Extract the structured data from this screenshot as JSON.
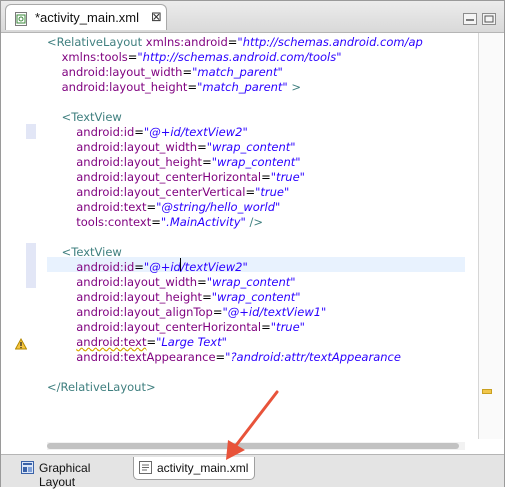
{
  "editor_tab": {
    "title": "*activity_main.xml",
    "close_glyph": "⊠"
  },
  "code_lines": [
    [
      {
        "c": "tag",
        "t": "<RelativeLayout "
      },
      {
        "c": "attr",
        "t": "xmlns:android"
      },
      {
        "c": "txt",
        "t": "="
      },
      {
        "c": "val",
        "t": "\"http://schemas.android.com/ap"
      }
    ],
    [
      {
        "c": "txt",
        "t": "    "
      },
      {
        "c": "attr",
        "t": "xmlns:tools"
      },
      {
        "c": "txt",
        "t": "="
      },
      {
        "c": "val",
        "t": "\"http://schemas.android.com/tools\""
      }
    ],
    [
      {
        "c": "txt",
        "t": "    "
      },
      {
        "c": "attr",
        "t": "android:layout_width"
      },
      {
        "c": "txt",
        "t": "="
      },
      {
        "c": "val",
        "t": "\"match_parent\""
      }
    ],
    [
      {
        "c": "txt",
        "t": "    "
      },
      {
        "c": "attr",
        "t": "android:layout_height"
      },
      {
        "c": "txt",
        "t": "="
      },
      {
        "c": "val",
        "t": "\"match_parent\""
      },
      {
        "c": "tag",
        "t": " >"
      }
    ],
    [],
    [
      {
        "c": "txt",
        "t": "    "
      },
      {
        "c": "tag",
        "t": "<TextView"
      }
    ],
    [
      {
        "c": "txt",
        "t": "        "
      },
      {
        "c": "attr",
        "t": "android:id"
      },
      {
        "c": "txt",
        "t": "="
      },
      {
        "c": "val",
        "t": "\"@+id/textView2\""
      }
    ],
    [
      {
        "c": "txt",
        "t": "        "
      },
      {
        "c": "attr",
        "t": "android:layout_width"
      },
      {
        "c": "txt",
        "t": "="
      },
      {
        "c": "val",
        "t": "\"wrap_content\""
      }
    ],
    [
      {
        "c": "txt",
        "t": "        "
      },
      {
        "c": "attr",
        "t": "android:layout_height"
      },
      {
        "c": "txt",
        "t": "="
      },
      {
        "c": "val",
        "t": "\"wrap_content\""
      }
    ],
    [
      {
        "c": "txt",
        "t": "        "
      },
      {
        "c": "attr",
        "t": "android:layout_centerHorizontal"
      },
      {
        "c": "txt",
        "t": "="
      },
      {
        "c": "val",
        "t": "\"true\""
      }
    ],
    [
      {
        "c": "txt",
        "t": "        "
      },
      {
        "c": "attr",
        "t": "android:layout_centerVertical"
      },
      {
        "c": "txt",
        "t": "="
      },
      {
        "c": "val",
        "t": "\"true\""
      }
    ],
    [
      {
        "c": "txt",
        "t": "        "
      },
      {
        "c": "attr",
        "t": "android:text"
      },
      {
        "c": "txt",
        "t": "="
      },
      {
        "c": "val",
        "t": "\"@string/hello_world\""
      }
    ],
    [
      {
        "c": "txt",
        "t": "        "
      },
      {
        "c": "attr",
        "t": "tools:context"
      },
      {
        "c": "txt",
        "t": "="
      },
      {
        "c": "val",
        "t": "\".MainActivity\""
      },
      {
        "c": "tag",
        "t": " />"
      }
    ],
    [],
    [
      {
        "c": "txt",
        "t": "    "
      },
      {
        "c": "tag",
        "t": "<TextView"
      }
    ],
    [
      {
        "c": "txt",
        "t": "        "
      },
      {
        "c": "attr",
        "t": "android:id"
      },
      {
        "c": "txt",
        "t": "="
      },
      {
        "c": "val",
        "t": "\"@+id/textView2\""
      }
    ],
    [
      {
        "c": "txt",
        "t": "        "
      },
      {
        "c": "attr",
        "t": "android:layout_width"
      },
      {
        "c": "txt",
        "t": "="
      },
      {
        "c": "val",
        "t": "\"wrap_content\""
      }
    ],
    [
      {
        "c": "txt",
        "t": "        "
      },
      {
        "c": "attr",
        "t": "android:layout_height"
      },
      {
        "c": "txt",
        "t": "="
      },
      {
        "c": "val",
        "t": "\"wrap_content\""
      }
    ],
    [
      {
        "c": "txt",
        "t": "        "
      },
      {
        "c": "attr",
        "t": "android:layout_alignTop"
      },
      {
        "c": "txt",
        "t": "="
      },
      {
        "c": "val",
        "t": "\"@+id/textView1\""
      }
    ],
    [
      {
        "c": "txt",
        "t": "        "
      },
      {
        "c": "attr",
        "t": "android:layout_centerHorizontal"
      },
      {
        "c": "txt",
        "t": "="
      },
      {
        "c": "val",
        "t": "\"true\""
      }
    ],
    [
      {
        "c": "txt",
        "t": "        "
      },
      {
        "c": "attr squiggle",
        "t": "android:text"
      },
      {
        "c": "txt",
        "t": "="
      },
      {
        "c": "val",
        "t": "\"Large Text\""
      }
    ],
    [
      {
        "c": "txt",
        "t": "        "
      },
      {
        "c": "attr",
        "t": "android:textAppearance"
      },
      {
        "c": "txt",
        "t": "="
      },
      {
        "c": "val",
        "t": "\"?android:attr/textAppearance"
      }
    ],
    [],
    [
      {
        "c": "tag",
        "t": "</RelativeLayout>"
      }
    ]
  ],
  "bottom_tabs": [
    {
      "label": "Graphical Layout",
      "icon": "graphical-layout-icon"
    },
    {
      "label": "activity_main.xml",
      "icon": "xml-source-icon"
    }
  ],
  "colors": {
    "tag": "#3f7f7f",
    "attribute": "#7f007f",
    "value": "#2a00ff",
    "current_line": "#e8f2fe",
    "annotation_arrow": "#e8533a"
  }
}
